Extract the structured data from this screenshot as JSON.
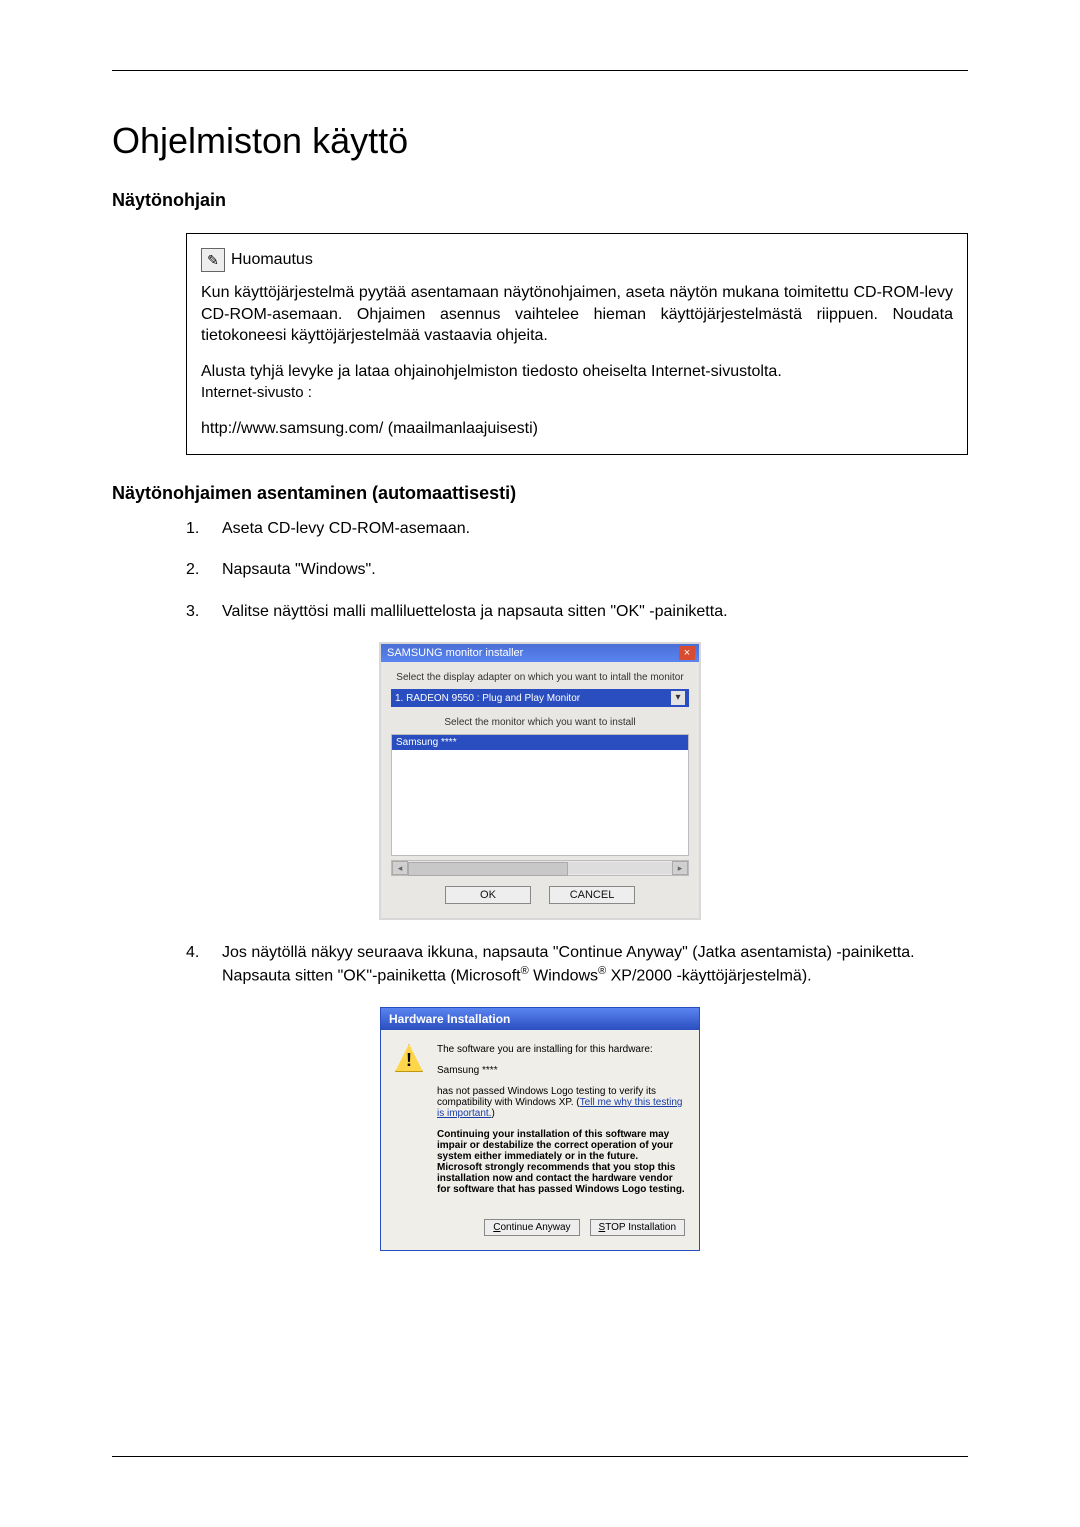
{
  "title": "Ohjelmiston käyttö",
  "section1": "Näytönohjain",
  "note": {
    "label": "Huomautus",
    "p1": "Kun käyttöjärjestelmä pyytää asentamaan näytönohjaimen, aseta näytön mukana toimitettu CD-ROM-levy CD-ROM-asemaan. Ohjaimen asennus vaihtelee hieman käyttöjärjestelmästä riippuen. Noudata tietokoneesi käyttöjärjestelmää vastaavia ohjeita.",
    "p2a": "Alusta tyhjä levyke ja lataa ohjainohjelmiston tiedosto oheiselta Internet-sivustolta.",
    "internet_label": "Internet-sivusto :",
    "url": "http://www.samsung.com/ (maailmanlaajuisesti)"
  },
  "subsection": "Näytönohjaimen asentaminen (automaattisesti)",
  "steps": {
    "s1": "Aseta CD-levy CD-ROM-asemaan.",
    "s2": "Napsauta \"Windows\".",
    "s3": "Valitse näyttösi malli malliluettelosta ja napsauta sitten \"OK\" -painiketta.",
    "s4a": "Jos näytöllä näkyy seuraava ikkuna, napsauta \"Continue Anyway\" (Jatka asentamista) -painiketta. Napsauta sitten \"OK\"-painiketta (Microsoft",
    "s4b": " Windows",
    "s4c": " XP/2000 -käyttöjärjestelmä)."
  },
  "installer": {
    "title": "SAMSUNG monitor installer",
    "line1": "Select the display adapter on which you want to intall the monitor",
    "adapter": "1. RADEON 9550 : Plug and Play Monitor",
    "line2": "Select the monitor which you want to install",
    "selected": "Samsung ****",
    "ok": "OK",
    "cancel": "CANCEL"
  },
  "hw": {
    "title": "Hardware Installation",
    "l1": "The software you are installing for this hardware:",
    "l2": "Samsung ****",
    "l3a": "has not passed Windows Logo testing to verify its compatibility with Windows XP. (",
    "l3link": "Tell me why this testing is important.",
    "l3b": ")",
    "l4": "Continuing your installation of this software may impair or destabilize the correct operation of your system either immediately or in the future. Microsoft strongly recommends that you stop this installation now and contact the hardware vendor for software that has passed Windows Logo testing.",
    "btn1_u": "C",
    "btn1_r": "ontinue Anyway",
    "btn2_u": "S",
    "btn2_r": "TOP Installation"
  }
}
